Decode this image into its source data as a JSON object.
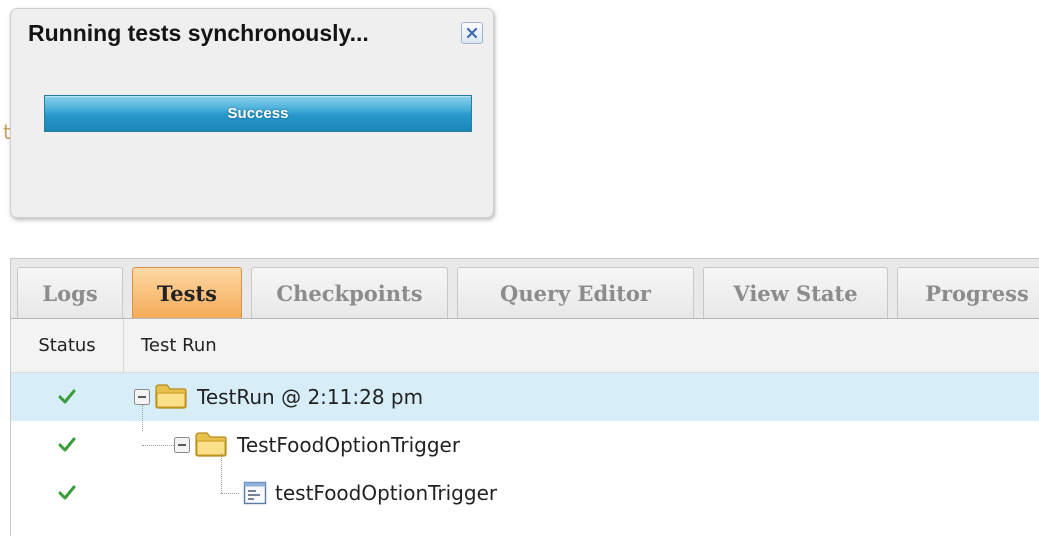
{
  "dialog": {
    "title": "Running tests synchronously...",
    "progress": {
      "label": "Success",
      "value": 1.0
    },
    "background_glyph": "t"
  },
  "tabs": [
    {
      "label": "Logs",
      "active": false
    },
    {
      "label": "Tests",
      "active": true
    },
    {
      "label": "Checkpoints",
      "active": false
    },
    {
      "label": "Query Editor",
      "active": false
    },
    {
      "label": "View State",
      "active": false
    },
    {
      "label": "Progress",
      "active": false
    }
  ],
  "grid": {
    "headers": {
      "status": "Status",
      "test_run": "Test Run"
    },
    "rows": [
      {
        "status": "pass",
        "label": "TestRun @ 2:11:28 pm",
        "icon": "folder-icon",
        "expanded": true,
        "selected": true
      },
      {
        "status": "pass",
        "label": "TestFoodOptionTrigger",
        "icon": "folder-icon",
        "expanded": true,
        "selected": false
      },
      {
        "status": "pass",
        "label": "testFoodOptionTrigger",
        "icon": "test-method-icon",
        "expanded": false,
        "selected": false
      }
    ]
  },
  "colors": {
    "progress_fill": "#2598ca",
    "active_tab": "#f4a957",
    "selected_row": "#d7eef8",
    "pass_check": "#3a9c3a"
  }
}
